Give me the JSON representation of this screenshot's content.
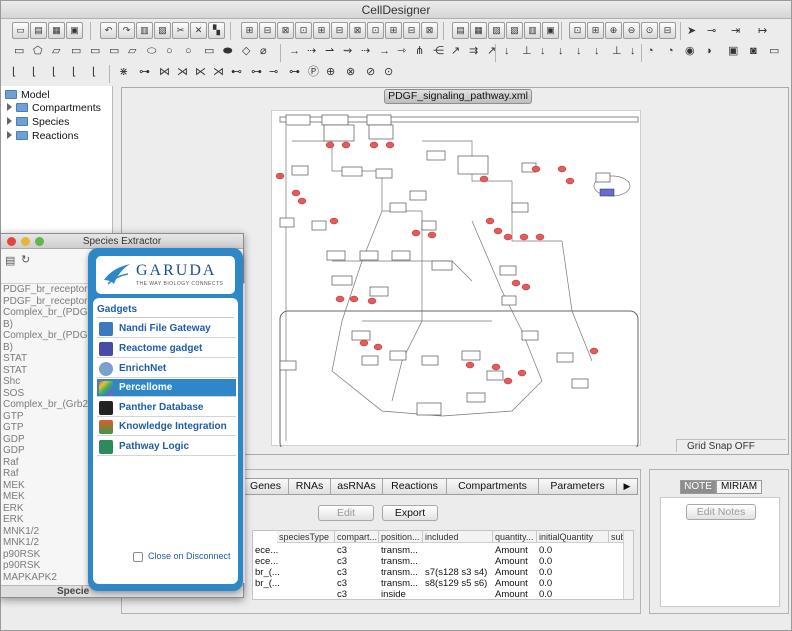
{
  "app": {
    "title": "CellDesigner"
  },
  "tree": {
    "root": "Model",
    "items": [
      {
        "label": "Compartments"
      },
      {
        "label": "Species"
      },
      {
        "label": "Reactions"
      }
    ]
  },
  "document": {
    "tab_label": "PDGF_signaling_pathway.xml",
    "grid_snap": "Grid Snap OFF"
  },
  "bottom": {
    "tabs": [
      "Genes",
      "RNAs",
      "asRNAs",
      "Reactions",
      "Compartments",
      "Parameters"
    ],
    "edit_label": "Edit",
    "export_label": "Export",
    "columns": [
      "speciesType",
      "compart...",
      "position...",
      "included",
      "quantity...",
      "initialQuantity",
      "sub"
    ],
    "rows": [
      {
        "name": "ece...",
        "compartment": "c3",
        "position": "transm...",
        "included": "",
        "quantity": "Amount",
        "initial": "0.0"
      },
      {
        "name": "ece...",
        "compartment": "c3",
        "position": "transm...",
        "included": "",
        "quantity": "Amount",
        "initial": "0.0"
      },
      {
        "name": "br_(...",
        "compartment": "c3",
        "position": "transm...",
        "included": "s7(s128 s3 s4)",
        "quantity": "Amount",
        "initial": "0.0"
      },
      {
        "name": "br_(...",
        "compartment": "c3",
        "position": "transm...",
        "included": "s8(s129 s5 s6)",
        "quantity": "Amount",
        "initial": "0.0"
      },
      {
        "name": "",
        "compartment": "c3",
        "position": "inside",
        "included": "",
        "quantity": "Amount",
        "initial": "0.0"
      }
    ]
  },
  "notes": {
    "note_tab": "NOTE",
    "miriam_tab": "MIRIAM",
    "edit_notes_label": "Edit Notes"
  },
  "species_extractor": {
    "title": "Species Extractor",
    "list": [
      "PDGF_br_receptor-",
      "PDGF_br_receptor",
      "Complex_br_(PDGF",
      "B)",
      "Complex_br_(PDGF",
      "B)",
      "STAT",
      "STAT",
      "Shc",
      "SOS",
      "Complex_br_(Grb2",
      "GTP",
      "GTP",
      "GDP",
      "GDP",
      "Raf",
      "Raf",
      "MEK",
      "MEK",
      "ERK",
      "ERK",
      "MNK1/2",
      "MNK1/2",
      "p90RSK",
      "p90RSK",
      "MAPKAPK2"
    ],
    "footer": "Specie"
  },
  "garuda": {
    "logo_text": "GARUDA",
    "logo_tagline": "THE WAY BIOLOGY CONNECTS",
    "gadgets_heading": "Gadgets",
    "gadgets": [
      {
        "label": "Nandi File Gateway",
        "color": "#3d78c2"
      },
      {
        "label": "Reactome gadget",
        "color": "#4a4aa8"
      },
      {
        "label": "EnrichNet",
        "color": "#7aa0d0"
      },
      {
        "label": "Percellome",
        "color": "#c94da2",
        "selected": true
      },
      {
        "label": "Panther Database",
        "color": "#222222"
      },
      {
        "label": "Knowledge Integration",
        "color": "#e05a2a"
      },
      {
        "label": "Pathway Logic",
        "color": "#2d8a5a"
      }
    ],
    "close_on_disconnect": "Close on Disconnect"
  },
  "colors": {
    "accent": "#2e88c8",
    "species_red": "#e55b5b"
  }
}
